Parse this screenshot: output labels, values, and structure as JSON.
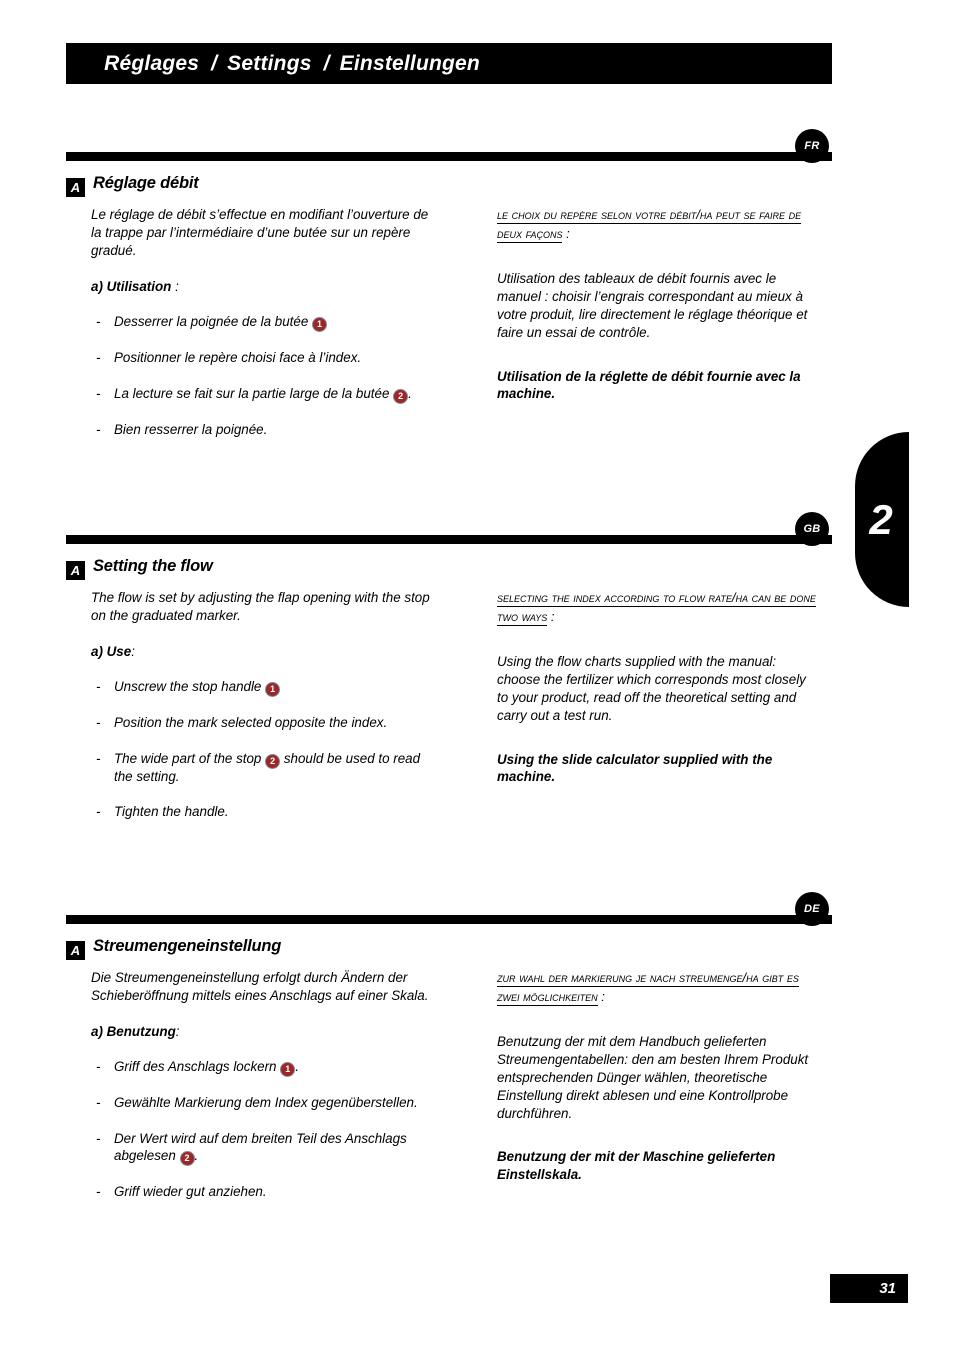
{
  "header": {
    "title_fr": "Réglages",
    "title_en": "Settings",
    "title_de": "Einstellungen",
    "separator": "/"
  },
  "chapter_tab": {
    "number": "2"
  },
  "footer": {
    "page_number": "31"
  },
  "colors": {
    "bar": "#000000",
    "marker_red": "#9c2727",
    "text": "#000000",
    "page_background": "#ffffff"
  },
  "sections": [
    {
      "lang_badge": "FR",
      "section_letter": "A",
      "heading": "Réglage débit",
      "intro": "Le réglage de débit s’effectue en modifiant l’ouverture de la trappe par l’intermédiaire d’une butée sur un repère gradué.",
      "sub_heading": "a) Utilisation",
      "sub_heading_suffix": " :",
      "bullets": [
        {
          "dash": "-",
          "pre": "Desserrer la poignée de la butée ",
          "marker": "1",
          "post": ""
        },
        {
          "dash": "-",
          "pre": "Positionner le repère choisi face à l’index.",
          "marker": "",
          "post": ""
        },
        {
          "dash": "-",
          "pre": "La lecture se fait sur la partie large de la butée ",
          "marker": "2",
          "post": "."
        },
        {
          "dash": "-",
          "pre": "Bien resserrer la poignée.",
          "marker": "",
          "post": ""
        }
      ],
      "lead_in": "Le choix du repère selon votre débit/ha peut se faire de deux façons",
      "lead_in_suffix": " :",
      "right_body": "Utilisation des tableaux de débit fournis avec le manuel : choisir l’engrais correspondant au mieux à votre produit, lire directement le réglage théorique et faire un essai de contrôle.",
      "right_bold": "Utilisation de la réglette de débit fournie avec la machine."
    },
    {
      "lang_badge": "GB",
      "section_letter": "A",
      "heading": "Setting the flow",
      "intro": "The flow is set by adjusting the flap opening with the stop on the graduated marker.",
      "sub_heading": "a) Use",
      "sub_heading_suffix": ":",
      "bullets": [
        {
          "dash": "-",
          "pre": "Unscrew the stop handle ",
          "marker": "1",
          "post": ""
        },
        {
          "dash": "-",
          "pre": "Position the mark selected opposite the index.",
          "marker": "",
          "post": ""
        },
        {
          "dash": "-",
          "pre": "The wide part of the stop ",
          "marker": "2",
          "post": " should be used to read the setting."
        },
        {
          "dash": "-",
          "pre": "Tighten the handle.",
          "marker": "",
          "post": ""
        }
      ],
      "lead_in": "Selecting the index according to flow rate/ha can be done two ways",
      "lead_in_suffix": " :",
      "right_body": "Using the flow charts supplied with the manual: choose the fertilizer which corresponds most closely to your product, read off the theoretical setting and carry out a test run.",
      "right_bold": "Using the slide calculator supplied with the machine."
    },
    {
      "lang_badge": "DE",
      "section_letter": "A",
      "heading": "Streumengeneinstellung",
      "intro": "Die Streumengeneinstellung erfolgt durch Ändern der Schieberöffnung mittels eines Anschlags auf einer Skala.",
      "sub_heading": "a) Benutzung",
      "sub_heading_suffix": ":",
      "bullets": [
        {
          "dash": "-",
          "pre": "Griff des Anschlags lockern ",
          "marker": "1",
          "post": "."
        },
        {
          "dash": "-",
          "pre": "Gewählte Markierung dem Index gegenüberstellen.",
          "marker": "",
          "post": ""
        },
        {
          "dash": "-",
          "pre": "Der Wert wird auf dem breiten Teil des Anschlags abgelesen ",
          "marker": "2",
          "post": "."
        },
        {
          "dash": "-",
          "pre": "Griff wieder gut anziehen.",
          "marker": "",
          "post": ""
        }
      ],
      "lead_in": "Zur Wahl der Markierung je nach Streumenge/ha gibt es zwei Möglichkeiten",
      "lead_in_suffix": " :",
      "right_body": "Benutzung der mit dem Handbuch gelieferten Streumengentabellen: den am besten Ihrem Produkt entsprechenden Dünger wählen, theoretische Einstellung direkt ablesen und eine Kontrollprobe durchführen.",
      "right_bold": "Benutzung der mit der Maschine gelieferten Einstellskala."
    }
  ]
}
